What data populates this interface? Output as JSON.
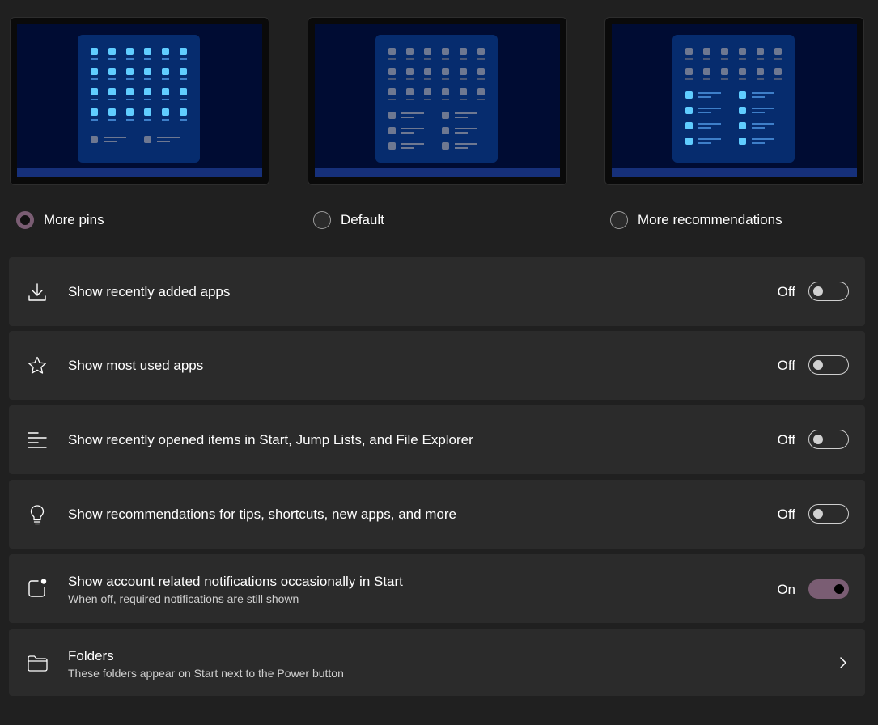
{
  "layout_options": [
    {
      "label": "More pins",
      "checked": true
    },
    {
      "label": "Default",
      "checked": false
    },
    {
      "label": "More recommendations",
      "checked": false
    }
  ],
  "settings": [
    {
      "icon": "download-icon",
      "title": "Show recently added apps",
      "state": "Off"
    },
    {
      "icon": "star-icon",
      "title": "Show most used apps",
      "state": "Off"
    },
    {
      "icon": "recent-list-icon",
      "title": "Show recently opened items in Start, Jump Lists, and File Explorer",
      "state": "Off"
    },
    {
      "icon": "lightbulb-icon",
      "title": "Show recommendations for tips, shortcuts, new apps, and more",
      "state": "Off"
    },
    {
      "icon": "notification-badge-icon",
      "title": "Show account related notifications occasionally in Start",
      "subtitle": "When off, required notifications are still shown",
      "state": "On"
    }
  ],
  "folders": {
    "icon": "folder-icon",
    "title": "Folders",
    "subtitle": "These folders appear on Start next to the Power button"
  },
  "colors": {
    "background": "#202020",
    "card": "#2b2b2b",
    "accent": "#7a5d73",
    "tile_active": "#60cdff",
    "tile_inactive": "#6e7891"
  }
}
